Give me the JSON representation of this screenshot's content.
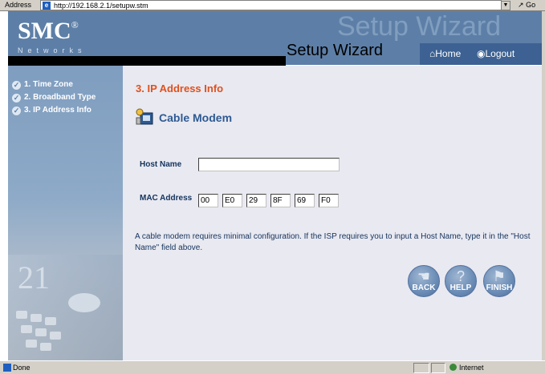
{
  "browser": {
    "address_label": "Address",
    "url": "http://192.168.2.1/setupw.stm",
    "go_label": "Go",
    "status_text": "Done",
    "zone_text": "Internet"
  },
  "header": {
    "logo": "SMC",
    "logo_mark": "®",
    "networks": "Networks",
    "background_title": "Setup Wizard",
    "title": "Setup Wizard",
    "home_label": "Home",
    "logout_label": "Logout"
  },
  "sidebar": {
    "items": [
      {
        "label": "1. Time Zone"
      },
      {
        "label": "2. Broadband Type"
      },
      {
        "label": "3. IP Address Info"
      }
    ]
  },
  "main": {
    "section_title": "3. IP Address Info",
    "connection_type": "Cable Modem",
    "host_name_label": "Host Name",
    "host_name_value": "",
    "mac_label": "MAC Address",
    "mac_octets": [
      "00",
      "E0",
      "29",
      "8F",
      "69",
      "F0"
    ],
    "description": "A cable modem requires minimal configuration. If the ISP requires you to input a Host Name, type it in the \"Host Name\" field above.",
    "back_label": "BACK",
    "help_label": "HELP",
    "finish_label": "FINISH"
  },
  "colors": {
    "header": "#5d7fa7",
    "accent_orange": "#e0501c",
    "label_blue": "#14335c",
    "content_bg": "#e9e9f1"
  }
}
